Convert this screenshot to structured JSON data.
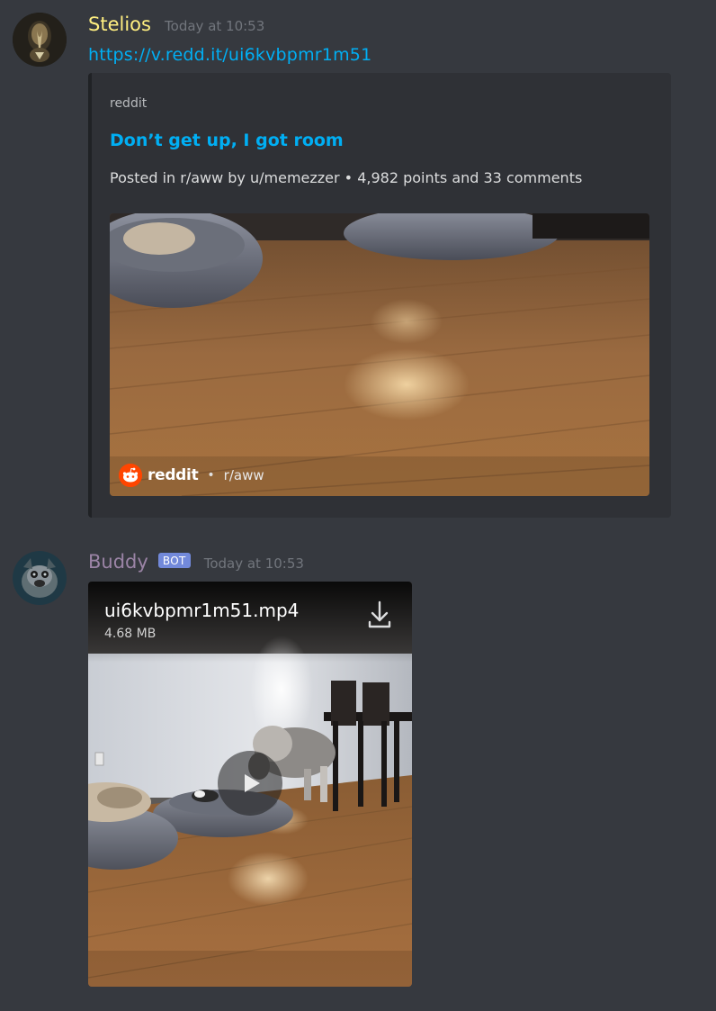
{
  "messages": {
    "first": {
      "username": "Stelios",
      "username_color": "#ffef80",
      "timestamp": "Today at 10:53",
      "link": "https://v.redd.it/ui6kvbpmr1m51",
      "embed": {
        "provider": "reddit",
        "title": "Don’t get up, I got room",
        "description": "Posted in r/aww by u/memezzer • 4,982 points and 33 comments",
        "media_brand": "reddit",
        "media_separator": "•",
        "media_subreddit": "r/aww"
      }
    },
    "second": {
      "username": "Buddy",
      "username_color": "#9b84a6",
      "bot_tag": "BOT",
      "timestamp": "Today at 10:53",
      "attachment": {
        "filename": "ui6kvbpmr1m51.mp4",
        "size": "4.68 MB"
      }
    }
  },
  "colors": {
    "background": "#36393f",
    "embed_background": "#2f3136",
    "link": "#00aff4",
    "bot_tag": "#7289da",
    "reddit_orange": "#ff4500"
  },
  "icons": {
    "download": "download-icon",
    "play": "play-icon",
    "reddit": "reddit-logo-icon"
  }
}
